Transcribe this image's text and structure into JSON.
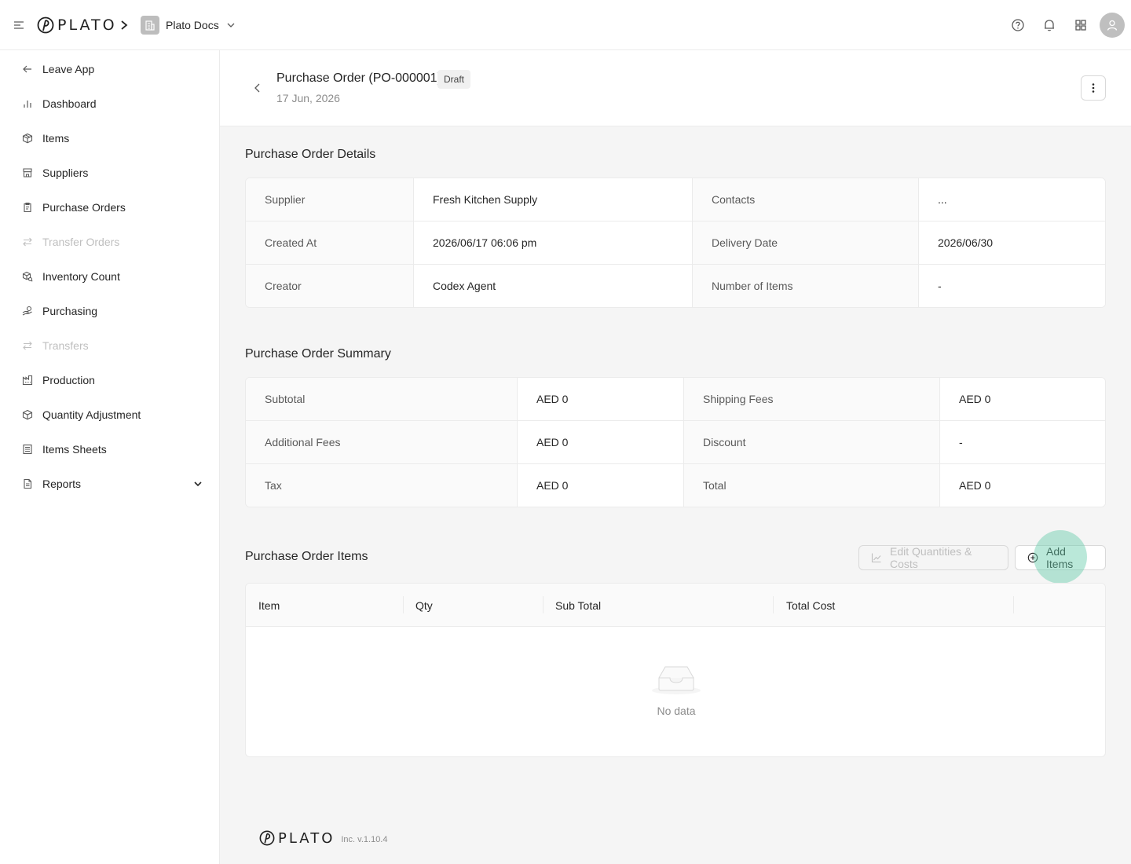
{
  "topbar": {
    "brand": "PLATO",
    "org_name": "Plato Docs",
    "icons": [
      "help-icon",
      "bell-icon",
      "apps-grid-icon",
      "user-icon"
    ]
  },
  "sidebar": {
    "items": [
      {
        "label": "Leave App",
        "icon": "arrow-left-icon",
        "disabled": false
      },
      {
        "label": "Dashboard",
        "icon": "bar-chart-icon",
        "disabled": false
      },
      {
        "label": "Items",
        "icon": "box-icon",
        "disabled": false
      },
      {
        "label": "Suppliers",
        "icon": "store-icon",
        "disabled": false
      },
      {
        "label": "Purchase Orders",
        "icon": "clipboard-icon",
        "disabled": false
      },
      {
        "label": "Transfer Orders",
        "icon": "transfer-icon",
        "disabled": true
      },
      {
        "label": "Inventory Count",
        "icon": "boxes-search-icon",
        "disabled": false
      },
      {
        "label": "Purchasing",
        "icon": "hand-coins-icon",
        "disabled": false
      },
      {
        "label": "Transfers",
        "icon": "transfer-icon",
        "disabled": true
      },
      {
        "label": "Production",
        "icon": "factory-icon",
        "disabled": false
      },
      {
        "label": "Quantity Adjustment",
        "icon": "box-adjust-icon",
        "disabled": false
      },
      {
        "label": "Items Sheets",
        "icon": "list-sheet-icon",
        "disabled": false
      },
      {
        "label": "Reports",
        "icon": "report-icon",
        "disabled": false
      }
    ]
  },
  "header": {
    "title": "Purchase Order (PO-000001)",
    "status": "Draft",
    "date": "17 Jun, 2026"
  },
  "details": {
    "title": "Purchase Order Details",
    "rows": [
      [
        {
          "label": "Supplier",
          "value": "Fresh Kitchen Supply"
        },
        {
          "label": "Contacts",
          "value": "..."
        }
      ],
      [
        {
          "label": "Created At",
          "value": "2026/06/17 06:06 pm"
        },
        {
          "label": "Delivery Date",
          "value": "2026/06/30"
        }
      ],
      [
        {
          "label": "Creator",
          "value": "Codex Agent"
        },
        {
          "label": "Number of Items",
          "value": "-"
        }
      ]
    ]
  },
  "summary": {
    "title": "Purchase Order Summary",
    "rows": [
      [
        {
          "label": "Subtotal",
          "value": "AED 0"
        },
        {
          "label": "Shipping Fees",
          "value": "AED 0"
        }
      ],
      [
        {
          "label": "Additional Fees",
          "value": "AED 0"
        },
        {
          "label": "Discount",
          "value": "-"
        }
      ],
      [
        {
          "label": "Tax",
          "value": "AED 0"
        },
        {
          "label": "Total",
          "value": "AED 0"
        }
      ]
    ]
  },
  "items": {
    "title": "Purchase Order Items",
    "edit_button": "Edit Quantities & Costs",
    "add_button": "Add Items",
    "columns": [
      "Item",
      "Qty",
      "Sub Total",
      "Total Cost"
    ],
    "empty_text": "No data"
  },
  "footer": {
    "brand": "PLATO",
    "version": "Inc. v.1.10.4"
  }
}
